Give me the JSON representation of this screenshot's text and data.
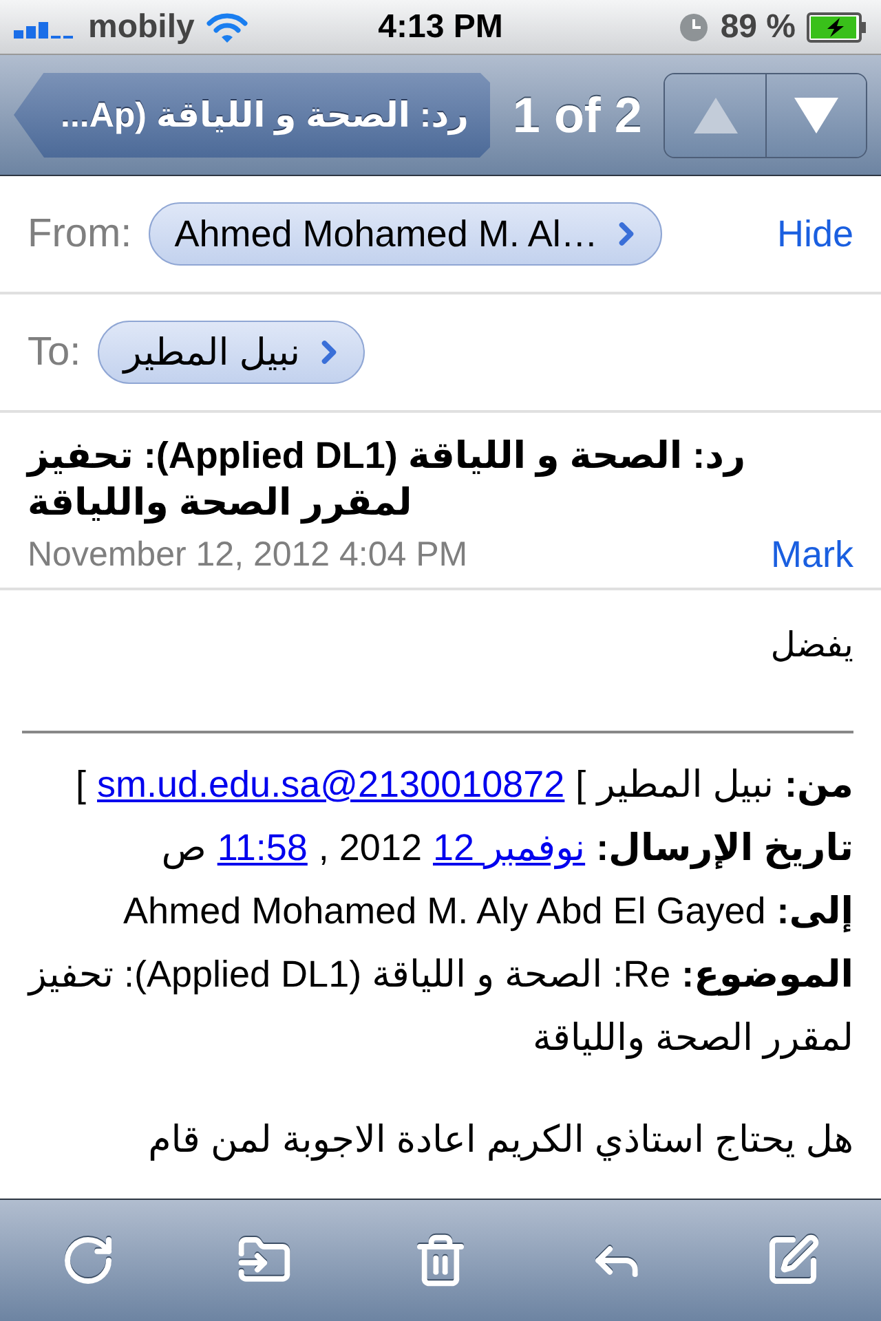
{
  "status_bar": {
    "carrier": "mobily",
    "time": "4:13 PM",
    "battery": "89 %"
  },
  "nav_bar": {
    "back": "رد: الصحة و اللياقة (Ap...",
    "counter": "1 of 2",
    "previous": {
      "disabled": true
    },
    "next": {
      "disabled": false
    }
  },
  "from": {
    "label": "From:",
    "sender": "Ahmed Mohamed M. Al…",
    "action": "Hide"
  },
  "to": {
    "label": "To:",
    "recipient": "نبيل المطير"
  },
  "subject": "رد: الصحة و اللياقة (Applied DL1): تحفيز لمقرر الصحة واللياقة",
  "date": "November 12, 2012 4:04 PM",
  "mark": "Mark",
  "body": {
    "greeting": "يفضل",
    "quoted_header": [
      [
        {
          "kind": "label",
          "text": "من:"
        },
        {
          "kind": "plain",
          "text": "نبيل المطير"
        },
        {
          "kind": "plain",
          "text": "["
        },
        {
          "kind": "link",
          "text": "sm.ud.edu.sa@2130010872"
        },
        {
          "kind": "plain",
          "text": "["
        }
      ],
      [
        {
          "kind": "label",
          "text": "تاريخ الإرسال:"
        },
        {
          "kind": "link",
          "text": "12 نوفمبر"
        },
        {
          "kind": "plain",
          "text": ", 2012"
        },
        {
          "kind": "link",
          "text": "11:58"
        },
        {
          "kind": "plain",
          "text": "ص"
        }
      ],
      [
        {
          "kind": "label",
          "text": "إلى:"
        },
        {
          "kind": "plain",
          "text": "Ahmed Mohamed M. Aly Abd El Gayed"
        }
      ],
      [
        {
          "kind": "label",
          "text": "الموضوع:"
        },
        {
          "kind": "plain",
          "text": "Re: الصحة و اللياقة (Applied DL1): تحفيز لمقرر الصحة واللياقة"
        }
      ]
    ],
    "paragraph": "هل يحتاج استاذي الكريم اعادة الاجوبة لمن قام"
  },
  "toolbar": [
    {
      "kind": "refresh"
    },
    {
      "kind": "move"
    },
    {
      "kind": "trash"
    },
    {
      "kind": "reply"
    },
    {
      "kind": "compose"
    }
  ]
}
